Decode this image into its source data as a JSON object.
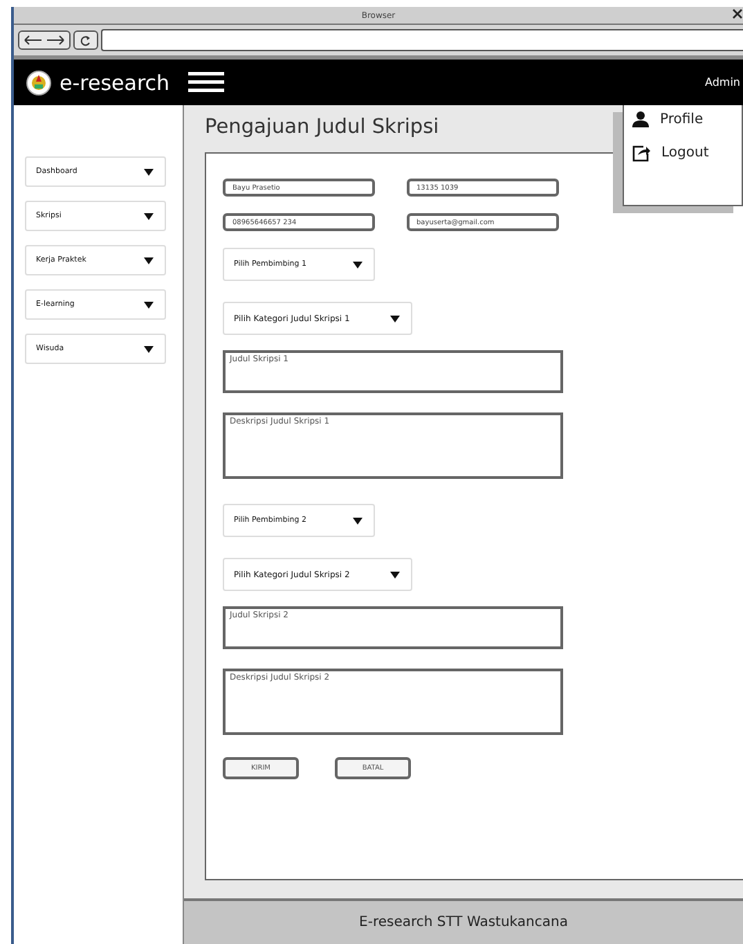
{
  "window": {
    "title": "Browser"
  },
  "header": {
    "brand": "e-research",
    "user": "Admin"
  },
  "user_menu": {
    "items": [
      {
        "kind": "profile",
        "label": "Profile"
      },
      {
        "kind": "logout",
        "label": "Logout"
      }
    ]
  },
  "sidebar": {
    "items": [
      {
        "label": "Dashboard"
      },
      {
        "label": "Skripsi"
      },
      {
        "label": "Kerja Praktek"
      },
      {
        "label": "E-learning"
      },
      {
        "label": "Wisuda"
      }
    ]
  },
  "page": {
    "title": "Pengajuan Judul Skripsi"
  },
  "form": {
    "text_fields": [
      {
        "value": "Bayu Prasetio"
      },
      {
        "value": "13135 1039"
      },
      {
        "value": "08965646657 234"
      },
      {
        "value": "bayuserta@gmail.com"
      }
    ],
    "fields": [
      {
        "kind": "select",
        "label": "Pilih Pembimbing 1"
      },
      {
        "kind": "select",
        "label": "Pilih Kategori Judul Skripsi 1"
      },
      {
        "kind": "textarea",
        "placeholder": "Judul Skripsi 1"
      },
      {
        "kind": "textarea",
        "placeholder": "Deskripsi Judul Skripsi 1"
      },
      {
        "kind": "select",
        "label": "Pilih Pembimbing 2"
      },
      {
        "kind": "select",
        "label": "Pilih Kategori Judul Skripsi 2"
      },
      {
        "kind": "textarea",
        "placeholder": "Judul Skripsi 2"
      },
      {
        "kind": "textarea",
        "placeholder": "Deskripsi Judul Skripsi 2"
      }
    ],
    "buttons": [
      {
        "label": "KIRIM"
      },
      {
        "label": "BATAL"
      }
    ]
  },
  "footer": {
    "text": "E-research STT Wastukancana"
  }
}
